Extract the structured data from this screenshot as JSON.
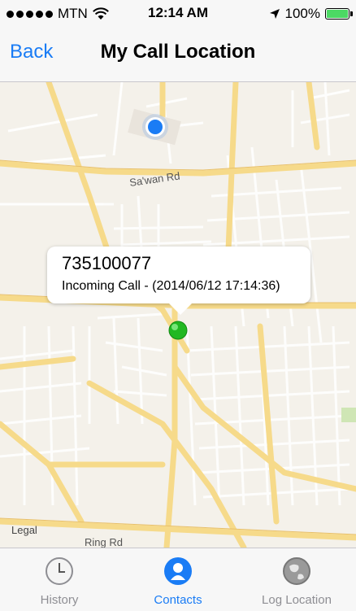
{
  "status_bar": {
    "carrier": "MTN",
    "time": "12:14 AM",
    "battery": "100%",
    "battery_level": 1.0
  },
  "nav": {
    "back_label": "Back",
    "title": "My Call Location"
  },
  "map": {
    "road_labels": {
      "sawan": "Sa'wan Rd",
      "ring": "Ring Rd"
    },
    "legal": "Legal",
    "callout": {
      "number": "735100077",
      "detail": "Incoming Call - (2014/06/12 17:14:36)"
    }
  },
  "tabs": [
    {
      "label": "History",
      "icon": "clock-icon",
      "active": false
    },
    {
      "label": "Contacts",
      "icon": "contact-icon",
      "active": true
    },
    {
      "label": "Log Location",
      "icon": "globe-icon",
      "active": false
    }
  ],
  "colors": {
    "accent": "#1a7cf5",
    "road": "#f6da8a",
    "map_bg": "#f4f1ea",
    "pin": "#22b822",
    "user_dot": "#1a7cf5"
  }
}
